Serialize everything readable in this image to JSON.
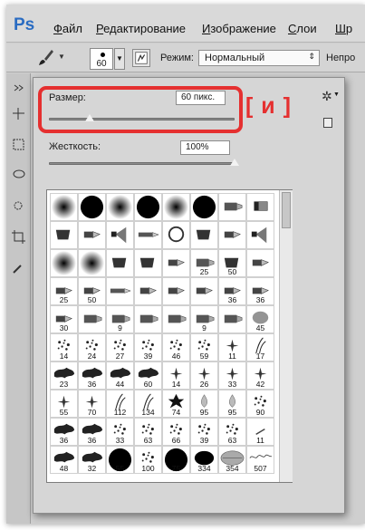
{
  "app": {
    "logo": "Ps"
  },
  "menu": [
    {
      "label": "Файл",
      "underline": "Ф",
      "rest": "айл"
    },
    {
      "label": "Редактирование",
      "underline": "Р",
      "rest": "едактирование"
    },
    {
      "label": "Изображение",
      "underline": "И",
      "rest": "зображение"
    },
    {
      "label": "Слои",
      "underline": "С",
      "rest": "лои"
    },
    {
      "label": "Шр",
      "underline": "Ш",
      "rest": "р"
    }
  ],
  "options": {
    "brush_size": "60",
    "mode_label": "Режим:",
    "mode_value": "Нормальный",
    "opacity_label": "Непро"
  },
  "brush_panel": {
    "size_label": "Размер:",
    "size_value": "60 пикс.",
    "size_fraction": 0.22,
    "hardness_label": "Жесткость:",
    "hardness_value": "100%",
    "hardness_fraction": 1.0,
    "hotkey_hint": "[ и ]"
  },
  "presets": [
    {
      "type": "soft",
      "n": ""
    },
    {
      "type": "hard",
      "n": ""
    },
    {
      "type": "soft",
      "n": ""
    },
    {
      "type": "hard",
      "n": ""
    },
    {
      "type": "soft",
      "n": ""
    },
    {
      "type": "hard",
      "n": ""
    },
    {
      "type": "marker",
      "n": ""
    },
    {
      "type": "marker2",
      "n": ""
    },
    {
      "type": "flat",
      "n": ""
    },
    {
      "type": "tip",
      "n": ""
    },
    {
      "type": "fan",
      "n": ""
    },
    {
      "type": "pencil",
      "n": ""
    },
    {
      "type": "round",
      "n": ""
    },
    {
      "type": "flat",
      "n": ""
    },
    {
      "type": "tip",
      "n": ""
    },
    {
      "type": "fan",
      "n": ""
    },
    {
      "type": "soft",
      "n": ""
    },
    {
      "type": "soft",
      "n": ""
    },
    {
      "type": "flat",
      "n": ""
    },
    {
      "type": "flat",
      "n": ""
    },
    {
      "type": "tip",
      "n": ""
    },
    {
      "type": "marker",
      "n": "25"
    },
    {
      "type": "flat",
      "n": "50"
    },
    {
      "type": "tip",
      "n": ""
    },
    {
      "type": "tip",
      "n": "25"
    },
    {
      "type": "tip",
      "n": "50"
    },
    {
      "type": "pencil",
      "n": ""
    },
    {
      "type": "tip",
      "n": ""
    },
    {
      "type": "tip",
      "n": ""
    },
    {
      "type": "tip",
      "n": ""
    },
    {
      "type": "tip",
      "n": "36"
    },
    {
      "type": "tip",
      "n": "36"
    },
    {
      "type": "tip",
      "n": "30"
    },
    {
      "type": "marker",
      "n": ""
    },
    {
      "type": "marker",
      "n": "9"
    },
    {
      "type": "marker",
      "n": ""
    },
    {
      "type": "marker",
      "n": ""
    },
    {
      "type": "marker",
      "n": "9"
    },
    {
      "type": "marker",
      "n": ""
    },
    {
      "type": "smudge",
      "n": "45"
    },
    {
      "type": "dots",
      "n": "14"
    },
    {
      "type": "dots",
      "n": "24"
    },
    {
      "type": "dots",
      "n": "27"
    },
    {
      "type": "dots",
      "n": "39"
    },
    {
      "type": "dots",
      "n": "46"
    },
    {
      "type": "dots",
      "n": "59"
    },
    {
      "type": "star",
      "n": "11"
    },
    {
      "type": "grass",
      "n": "17"
    },
    {
      "type": "splat",
      "n": "23"
    },
    {
      "type": "splat",
      "n": "36"
    },
    {
      "type": "splat",
      "n": "44"
    },
    {
      "type": "splat",
      "n": "60"
    },
    {
      "type": "star",
      "n": "14"
    },
    {
      "type": "star",
      "n": "26"
    },
    {
      "type": "star",
      "n": "33"
    },
    {
      "type": "star",
      "n": "42"
    },
    {
      "type": "star",
      "n": "55"
    },
    {
      "type": "star",
      "n": "70"
    },
    {
      "type": "grass",
      "n": "112"
    },
    {
      "type": "grass",
      "n": "134"
    },
    {
      "type": "leaf",
      "n": "74"
    },
    {
      "type": "drop",
      "n": "95"
    },
    {
      "type": "drop",
      "n": "95"
    },
    {
      "type": "dots",
      "n": "90"
    },
    {
      "type": "splat",
      "n": "36"
    },
    {
      "type": "splat",
      "n": "36"
    },
    {
      "type": "dots",
      "n": "33"
    },
    {
      "type": "dots",
      "n": "63"
    },
    {
      "type": "dots",
      "n": "66"
    },
    {
      "type": "dots",
      "n": "39"
    },
    {
      "type": "dots",
      "n": "63"
    },
    {
      "type": "line",
      "n": "11"
    },
    {
      "type": "splat",
      "n": "48"
    },
    {
      "type": "splat",
      "n": "32"
    },
    {
      "type": "hard",
      "n": "55"
    },
    {
      "type": "dots",
      "n": "100"
    },
    {
      "type": "hard",
      "n": "75"
    },
    {
      "type": "blob",
      "n": "334"
    },
    {
      "type": "oval",
      "n": "354"
    },
    {
      "type": "script",
      "n": "507"
    }
  ],
  "colors": {
    "hotkey": "#e53030",
    "logo": "#2a6cc2"
  }
}
